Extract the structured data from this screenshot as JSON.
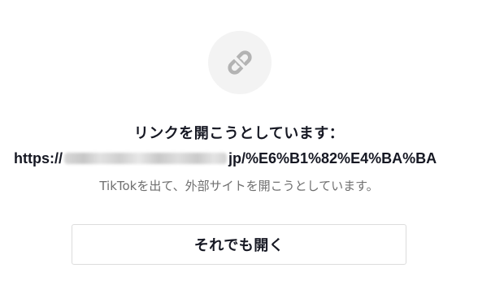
{
  "dialog": {
    "icon": "link-icon",
    "title": "リンクを開こうとしています：",
    "url_prefix": "https://",
    "url_suffix": "jp/%E6%B1%82%E4%BA%BA",
    "subtitle": "TikTokを出て、外部サイトを開こうとしています。",
    "button_label": "それでも開く"
  },
  "colors": {
    "icon_bg": "#f3f3f3",
    "icon_stroke": "#b3b3b3",
    "title_text": "#161823",
    "subtitle_text": "#6f6f6f",
    "button_border": "#dcdcdc"
  }
}
